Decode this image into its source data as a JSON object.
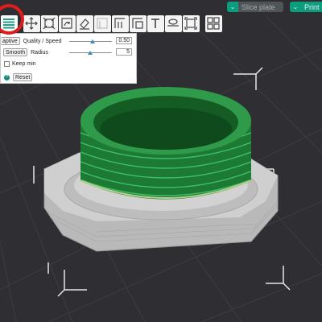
{
  "header": {
    "slice_button_label": "Slice plate",
    "print_button_label": "Print"
  },
  "toolbar": {
    "tools": [
      {
        "icon": "variable-layer-height-icon",
        "active": true
      },
      {
        "icon": "move-icon"
      },
      {
        "icon": "scale-icon"
      },
      {
        "icon": "rotate-icon"
      },
      {
        "icon": "paint-brush-icon"
      },
      {
        "icon": "support-paint-icon"
      },
      {
        "icon": "seam-paint-icon"
      },
      {
        "icon": "fuzzy-skin-icon"
      },
      {
        "icon": "text-emboss-icon"
      },
      {
        "icon": "brim-ears-icon"
      },
      {
        "icon": "measure-icon"
      },
      {
        "icon": "assembly-icon"
      }
    ]
  },
  "panel": {
    "adaptive_label": "aptive",
    "quality_label": "Quality / Speed",
    "quality_value": "0.50",
    "smooth_label": "Smooth",
    "radius_label": "Radius",
    "radius_value": "5",
    "keep_min_label": "Keep min",
    "reset_label": "Reset"
  },
  "colors": {
    "background": "#2f2f33",
    "accent": "#0d9c7d",
    "model_grey": "#c8c8c8",
    "thread_green": "#1f8a3c",
    "highlight_ring": "#e01c1c"
  }
}
